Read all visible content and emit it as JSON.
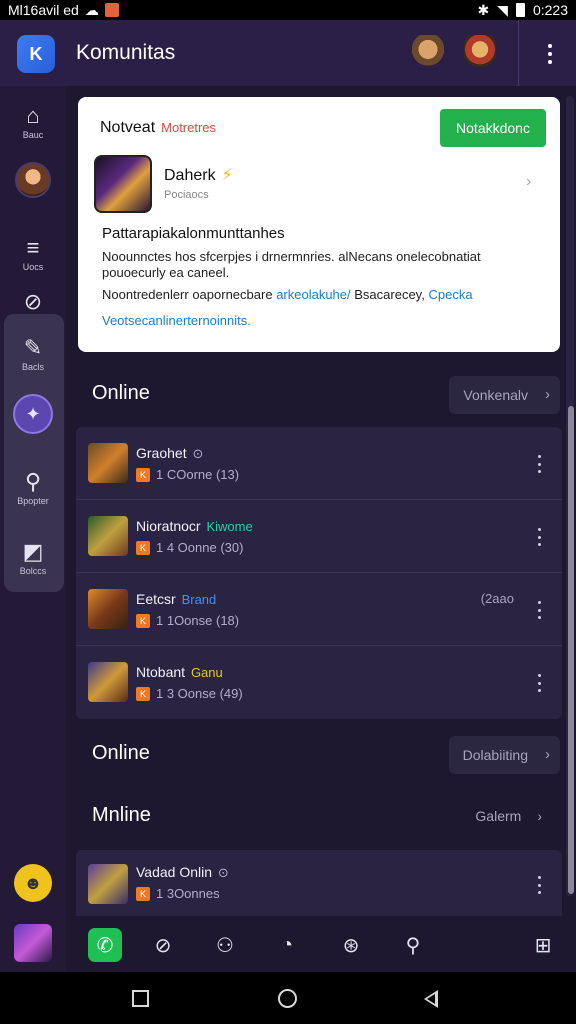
{
  "status_bar": {
    "left_text": "Ml16avil ed",
    "time": "0:223"
  },
  "header": {
    "title": "Komunitas",
    "logo_glyph": "K"
  },
  "rail": {
    "items": [
      {
        "label": "Bauc",
        "glyph": "⌂"
      },
      {
        "label": "Uocs",
        "glyph": "≡"
      },
      {
        "label": "Bacls",
        "glyph": "✎"
      },
      {
        "label": "Bpopter",
        "glyph": "⚲"
      },
      {
        "label": "Bolccs",
        "glyph": "◩"
      }
    ]
  },
  "notification": {
    "title": "Notveat",
    "title_accent": "Motretres",
    "action_label": "Notakkdonc",
    "game_name": "Daherk",
    "game_sub": "Pociaocs",
    "heading": "Pattarapiakalonmunttanhes",
    "body_line1": "Noounnctes hos sfcerpjes i drnermnries. alNecans onelecobnatiat pouoecurly ea caneel.",
    "body_line2_plain": "Noontredenlerr oapornecbare",
    "body_line2_link1": "arkeolakuhe/",
    "body_line2_plain2": "Bsacarecey,",
    "body_line2_link2": "Cpecka",
    "body_line3_link": "Veotsecanlinerternoinnits."
  },
  "sections": {
    "online1": {
      "label": "Online",
      "action": "Vonkenalv"
    },
    "online2": {
      "label": "Online",
      "action": "Dolabiiting"
    },
    "online3": {
      "label": "Mnline",
      "action": "Galerm"
    }
  },
  "games": [
    {
      "name": "Graohet",
      "tag": "⊙",
      "tag_color": "#b4afc8",
      "meta": "1 COorne (13)",
      "right": ""
    },
    {
      "name": "Nioratnocr",
      "tag": "Kiwome",
      "tag_color": "#2bd0a8",
      "meta": "1 4 Oonne (30)",
      "right": ""
    },
    {
      "name": "Eetcsr",
      "tag": "Brand",
      "tag_color": "#4a8df0",
      "meta": "1 1Oonse (18)",
      "right": "(2aao"
    },
    {
      "name": "Ntobant",
      "tag": "Ganu",
      "tag_color": "#f0c31c",
      "meta": "1 3 Oonse (49)",
      "right": ""
    }
  ],
  "bottom_game": {
    "name": "Vadad Onlin",
    "tag": "⊙",
    "meta": "1 3Oonnes"
  },
  "tabs": [
    "phone",
    "compass",
    "search-person",
    "clock",
    "globe",
    "search",
    "grid"
  ],
  "colors": {
    "accent_green": "#22b14c",
    "brand_purple": "#2b1f48",
    "background": "#1d1830",
    "card": "#2a2342"
  }
}
